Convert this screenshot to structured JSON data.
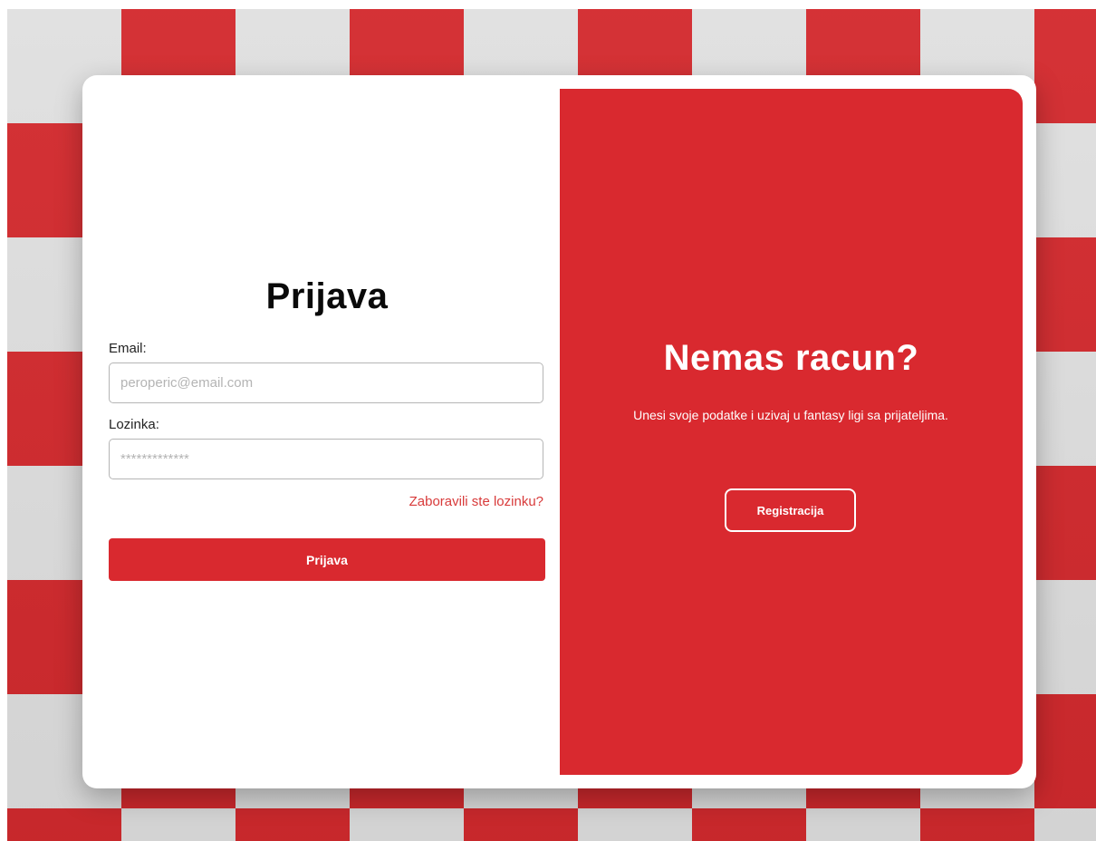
{
  "login": {
    "title": "Prijava",
    "email_label": "Email:",
    "email_placeholder": "peroperic@email.com",
    "password_label": "Lozinka:",
    "password_placeholder": "*************",
    "forgot_link": "Zaboravili ste lozinku?",
    "submit_label": "Prijava"
  },
  "register_panel": {
    "title": "Nemas racun?",
    "description": "Unesi svoje podatke i uzivaj u fantasy ligi sa prijateljima.",
    "button_label": "Registracija"
  },
  "colors": {
    "accent": "#d9292f",
    "link": "#d83a3a"
  }
}
